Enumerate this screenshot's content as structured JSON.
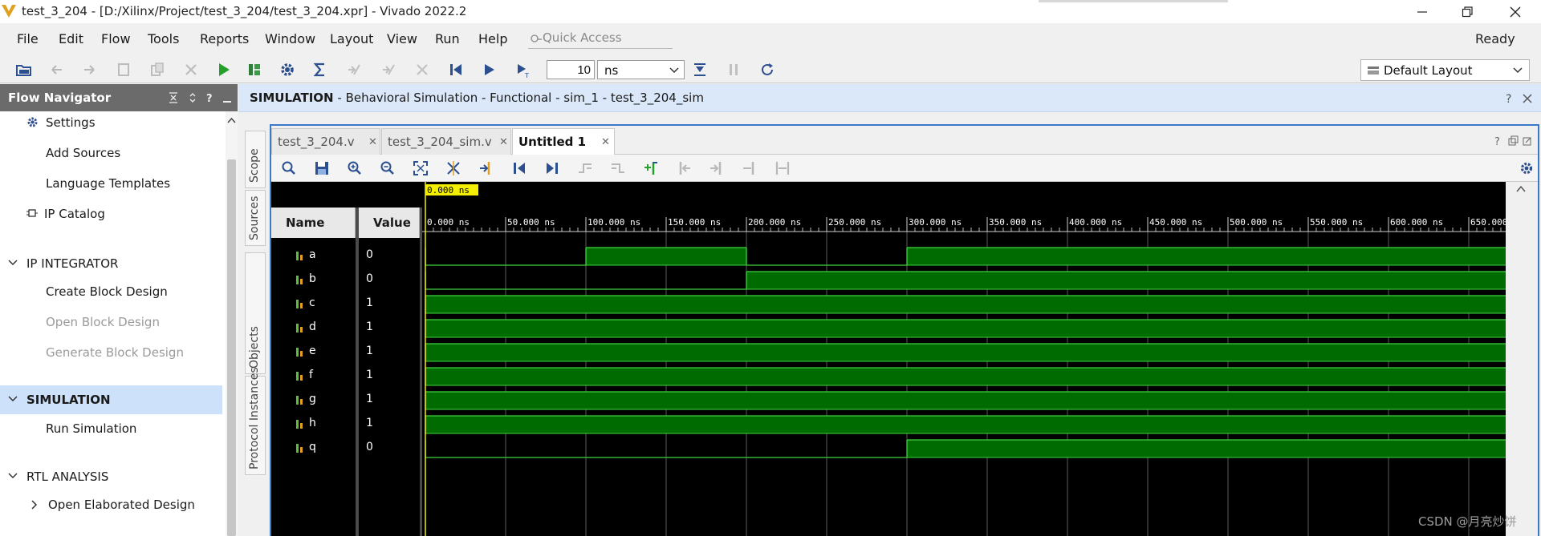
{
  "window": {
    "title": "test_3_204 - [D:/Xilinx/Project/test_3_204/test_3_204.xpr] - Vivado 2022.2"
  },
  "menu": {
    "items": [
      "File",
      "Edit",
      "Flow",
      "Tools",
      "Reports",
      "Window",
      "Layout",
      "View",
      "Run",
      "Help"
    ],
    "quick_access_placeholder": "Quick Access",
    "status": "Ready"
  },
  "toolbar": {
    "time_value": "10",
    "time_unit": "ns",
    "layout": "Default Layout"
  },
  "flow_navigator": {
    "title": "Flow Navigator",
    "items": {
      "settings": "Settings",
      "add_sources": "Add Sources",
      "language_templates": "Language Templates",
      "ip_catalog": "IP Catalog",
      "ip_integrator": "IP INTEGRATOR",
      "create_block_design": "Create Block Design",
      "open_block_design": "Open Block Design",
      "generate_block_design": "Generate Block Design",
      "simulation": "SIMULATION",
      "run_simulation": "Run Simulation",
      "rtl_analysis": "RTL ANALYSIS",
      "open_elaborated_design": "Open Elaborated Design"
    }
  },
  "simulation_header": {
    "label": "SIMULATION",
    "detail": " - Behavioral Simulation - Functional - sim_1 - test_3_204_sim"
  },
  "side_tabs": [
    "Scope",
    "Sources",
    "Objects",
    "Protocol Instances"
  ],
  "wave_tabs": [
    {
      "label": "test_3_204.v",
      "active": false
    },
    {
      "label": "test_3_204_sim.v",
      "active": false
    },
    {
      "label": "Untitled 1",
      "active": true
    }
  ],
  "waveform": {
    "cursor_label": "0.000 ns",
    "col_name": "Name",
    "col_value": "Value",
    "time_ticks": [
      "0.000 ns",
      "50.000 ns",
      "100.000 ns",
      "150.000 ns",
      "200.000 ns",
      "250.000 ns",
      "300.000 ns",
      "350.000 ns",
      "400.000 ns",
      "450.000 ns",
      "500.000 ns",
      "550.000 ns",
      "600.000 ns",
      "650.000"
    ],
    "time_end_ns": 676,
    "signals": [
      {
        "name": "a",
        "value": "0",
        "transitions": [
          [
            0,
            0
          ],
          [
            100,
            1
          ],
          [
            200,
            0
          ],
          [
            300,
            1
          ]
        ]
      },
      {
        "name": "b",
        "value": "0",
        "transitions": [
          [
            0,
            0
          ],
          [
            200,
            1
          ]
        ]
      },
      {
        "name": "c",
        "value": "1",
        "transitions": [
          [
            0,
            1
          ]
        ]
      },
      {
        "name": "d",
        "value": "1",
        "transitions": [
          [
            0,
            1
          ]
        ]
      },
      {
        "name": "e",
        "value": "1",
        "transitions": [
          [
            0,
            1
          ]
        ]
      },
      {
        "name": "f",
        "value": "1",
        "transitions": [
          [
            0,
            1
          ]
        ]
      },
      {
        "name": "g",
        "value": "1",
        "transitions": [
          [
            0,
            1
          ]
        ]
      },
      {
        "name": "h",
        "value": "1",
        "transitions": [
          [
            0,
            1
          ]
        ]
      },
      {
        "name": "q",
        "value": "0",
        "transitions": [
          [
            0,
            0
          ],
          [
            300,
            1
          ]
        ]
      }
    ]
  },
  "watermark": "CSDN @月亮炒饼"
}
